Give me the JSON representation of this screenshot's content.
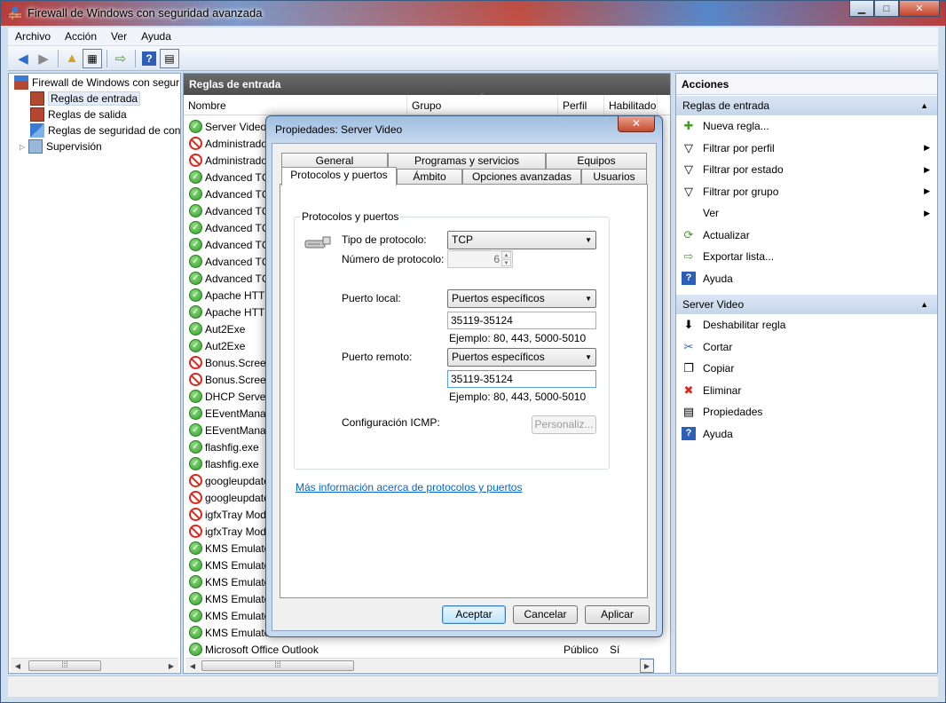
{
  "window": {
    "title": "Firewall de Windows con seguridad avanzada"
  },
  "menu": [
    "Archivo",
    "Acción",
    "Ver",
    "Ayuda"
  ],
  "tree": {
    "root": "Firewall de Windows con segur",
    "items": [
      "Reglas de entrada",
      "Reglas de salida",
      "Reglas de seguridad de con",
      "Supervisión"
    ]
  },
  "middle": {
    "header": "Reglas de entrada",
    "columns": {
      "name": "Nombre",
      "group": "Grupo",
      "profile": "Perfil",
      "enabled": "Habilitado"
    },
    "rules": [
      {
        "name": "Server Video",
        "type": "allow"
      },
      {
        "name": "Administrado",
        "type": "block"
      },
      {
        "name": "Administrado",
        "type": "block"
      },
      {
        "name": "Advanced TC",
        "type": "allow"
      },
      {
        "name": "Advanced TC",
        "type": "allow"
      },
      {
        "name": "Advanced TC",
        "type": "allow"
      },
      {
        "name": "Advanced TC",
        "type": "allow"
      },
      {
        "name": "Advanced TC",
        "type": "allow"
      },
      {
        "name": "Advanced TC",
        "type": "allow"
      },
      {
        "name": "Advanced TC",
        "type": "allow"
      },
      {
        "name": "Apache HTTP",
        "type": "allow"
      },
      {
        "name": "Apache HTTP",
        "type": "allow"
      },
      {
        "name": "Aut2Exe",
        "type": "allow"
      },
      {
        "name": "Aut2Exe",
        "type": "allow"
      },
      {
        "name": "Bonus.Screen",
        "type": "block"
      },
      {
        "name": "Bonus.Screen",
        "type": "block"
      },
      {
        "name": "DHCP Server",
        "type": "allow"
      },
      {
        "name": "EEventManag",
        "type": "allow"
      },
      {
        "name": "EEventManag",
        "type": "allow"
      },
      {
        "name": "flashfig.exe",
        "type": "allow"
      },
      {
        "name": "flashfig.exe",
        "type": "allow"
      },
      {
        "name": "googleupdate",
        "type": "block"
      },
      {
        "name": "googleupdate",
        "type": "block"
      },
      {
        "name": "igfxTray Mod",
        "type": "block"
      },
      {
        "name": "igfxTray Mod",
        "type": "block"
      },
      {
        "name": "KMS Emulato",
        "type": "allow"
      },
      {
        "name": "KMS Emulato",
        "type": "allow"
      },
      {
        "name": "KMS Emulato",
        "type": "allow"
      },
      {
        "name": "KMS Emulato",
        "type": "allow"
      },
      {
        "name": "KMS Emulato",
        "type": "allow"
      },
      {
        "name": "KMS Emulato",
        "type": "allow"
      },
      {
        "name": "Microsoft Office Outlook",
        "type": "allow",
        "profile": "Público",
        "enabled": "Sí"
      }
    ]
  },
  "actions": {
    "title": "Acciones",
    "section1": "Reglas de entrada",
    "items1": [
      {
        "label": "Nueva regla...",
        "icon": "new-rule-icon",
        "glyph": "✚",
        "sub": false
      },
      {
        "label": "Filtrar por perfil",
        "icon": "filter-icon",
        "glyph": "▽",
        "sub": true
      },
      {
        "label": "Filtrar por estado",
        "icon": "filter-icon",
        "glyph": "▽",
        "sub": true
      },
      {
        "label": "Filtrar por grupo",
        "icon": "filter-icon",
        "glyph": "▽",
        "sub": true
      },
      {
        "label": "Ver",
        "icon": "view-icon",
        "glyph": "",
        "sub": true
      },
      {
        "label": "Actualizar",
        "icon": "refresh-icon",
        "glyph": "⟳",
        "sub": false
      },
      {
        "label": "Exportar lista...",
        "icon": "export-icon",
        "glyph": "⇨",
        "sub": false
      },
      {
        "label": "Ayuda",
        "icon": "help-icon",
        "glyph": "?",
        "sub": false
      }
    ],
    "section2": "Server Video",
    "items2": [
      {
        "label": "Deshabilitar regla",
        "icon": "disable-icon",
        "glyph": "⬇"
      },
      {
        "label": "Cortar",
        "icon": "cut-icon",
        "glyph": "✂"
      },
      {
        "label": "Copiar",
        "icon": "copy-icon",
        "glyph": "❐"
      },
      {
        "label": "Eliminar",
        "icon": "delete-icon",
        "glyph": "✖"
      },
      {
        "label": "Propiedades",
        "icon": "properties-icon",
        "glyph": "▤"
      },
      {
        "label": "Ayuda",
        "icon": "help-icon",
        "glyph": "?"
      }
    ]
  },
  "dialog": {
    "title": "Propiedades: Server Video",
    "tabs_row1": [
      "General",
      "Programas y servicios",
      "Equipos"
    ],
    "tabs_row2": [
      "Protocolos y puertos",
      "Ámbito",
      "Opciones avanzadas",
      "Usuarios"
    ],
    "group_title": "Protocolos y puertos",
    "protocol_type_label": "Tipo de protocolo:",
    "protocol_type_value": "TCP",
    "protocol_number_label": "Número de protocolo:",
    "protocol_number_value": "6",
    "local_port_label": "Puerto local:",
    "local_port_mode": "Puertos específicos",
    "local_port_value": "35119-35124",
    "local_port_example": "Ejemplo: 80, 443, 5000-5010",
    "remote_port_label": "Puerto remoto:",
    "remote_port_mode": "Puertos específicos",
    "remote_port_value": "35119-35124",
    "remote_port_example": "Ejemplo: 80, 443, 5000-5010",
    "icmp_label": "Configuración ICMP:",
    "customize_button": "Personaliz...",
    "more_info_link": "Más información acerca de protocolos y puertos",
    "ok": "Aceptar",
    "cancel": "Cancelar",
    "apply": "Aplicar"
  },
  "colors": {
    "allow": "#2f9a2a",
    "block": "#d9281e",
    "accent": "#3c7fb1"
  }
}
